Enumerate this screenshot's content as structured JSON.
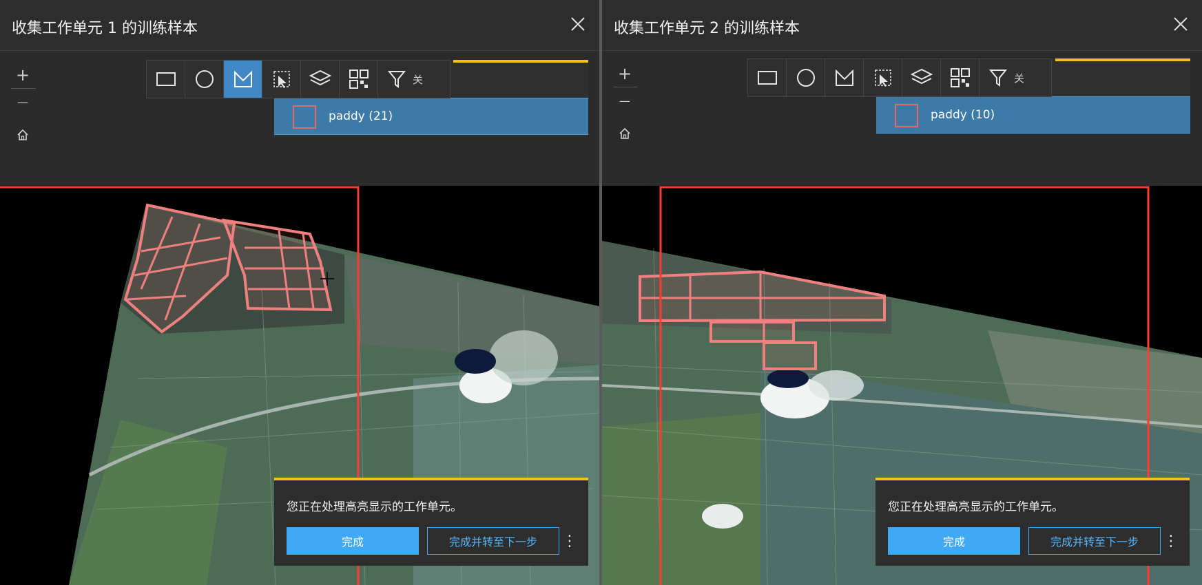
{
  "colors": {
    "accent_blue": "#3fa9f5",
    "active_tool": "#3f88c5",
    "highlight_yellow": "#f4c01c",
    "sample_red": "#e46a6a",
    "workunit_red": "#ff3b30"
  },
  "panels": [
    {
      "title": "收集工作单元 1 的训练样本",
      "active_tool": "polygon-icon",
      "tools": [
        "rectangle-icon",
        "circle-icon",
        "polygon-icon",
        "select-icon",
        "layers-icon",
        "qr-grid-icon"
      ],
      "filter_label": "关",
      "class_item": {
        "label": "paddy (21)"
      },
      "notification": {
        "message": "您正在处理高亮显示的工作单元。",
        "primary_label": "完成",
        "secondary_label": "完成并转至下一步",
        "more_label": "⋮"
      },
      "nav": {
        "zoom_in": "+",
        "zoom_out": "—"
      }
    },
    {
      "title": "收集工作单元 2 的训练样本",
      "active_tool": "",
      "tools": [
        "rectangle-icon",
        "circle-icon",
        "polygon-icon",
        "select-icon",
        "layers-icon",
        "qr-grid-icon"
      ],
      "filter_label": "关",
      "class_item": {
        "label": "paddy (10)"
      },
      "notification": {
        "message": "您正在处理高亮显示的工作单元。",
        "primary_label": "完成",
        "secondary_label": "完成并转至下一步",
        "more_label": "⋮"
      },
      "nav": {
        "zoom_in": "+",
        "zoom_out": "—"
      }
    }
  ]
}
